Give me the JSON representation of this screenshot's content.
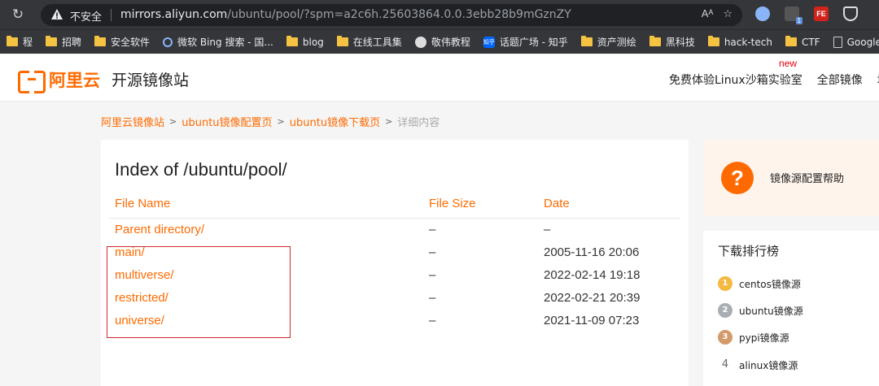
{
  "browser": {
    "insecure_label": "不安全",
    "url_host": "mirrors.aliyun.com",
    "url_path": "/ubuntu/pool/?spm=a2c6h.25603864.0.0.3ebb28b9mGznZY",
    "reader_label": "Aᴬ",
    "star_label": "☆",
    "reload_glyph": "↻",
    "badge_count": "1",
    "fe_label": "FE"
  },
  "bookmarks": [
    {
      "label": "程",
      "icon": "folder-icon"
    },
    {
      "label": "招聘",
      "icon": "folder-icon"
    },
    {
      "label": "安全软件",
      "icon": "folder-icon"
    },
    {
      "label": "微软 Bing 搜索 - 国...",
      "icon": "search-icon"
    },
    {
      "label": "blog",
      "icon": "folder-icon"
    },
    {
      "label": "在线工具集",
      "icon": "folder-icon"
    },
    {
      "label": "敬伟教程",
      "icon": "avatar-icon"
    },
    {
      "label": "话题广场 - 知乎",
      "icon": "zhihu-icon"
    },
    {
      "label": "资产测绘",
      "icon": "folder-icon"
    },
    {
      "label": "黑科技",
      "icon": "folder-icon"
    },
    {
      "label": "hack-tech",
      "icon": "folder-icon"
    },
    {
      "label": "CTF",
      "icon": "folder-icon"
    },
    {
      "label": "Google 翻译",
      "icon": "page-icon"
    }
  ],
  "zhihu_glyph": "知乎",
  "header": {
    "logo_text": "阿里云",
    "site_name": "开源镜像站",
    "nav": [
      "免费体验Linux沙箱实验室",
      "全部镜像",
      "域名"
    ],
    "new_badge": "new"
  },
  "breadcrumb": {
    "items": [
      "阿里云镜像站",
      "ubuntu镜像配置页",
      "ubuntu镜像下载页"
    ],
    "current": "详细内容",
    "separator": ">"
  },
  "listing": {
    "title": "Index of /ubuntu/pool/",
    "columns": [
      "File Name",
      "File Size",
      "Date"
    ],
    "rows": [
      {
        "name": "Parent directory/",
        "size": "–",
        "date": "–"
      },
      {
        "name": "main/",
        "size": "–",
        "date": "2005-11-16 20:06"
      },
      {
        "name": "multiverse/",
        "size": "–",
        "date": "2022-02-14 19:18"
      },
      {
        "name": "restricted/",
        "size": "–",
        "date": "2022-02-21 20:39"
      },
      {
        "name": "universe/",
        "size": "–",
        "date": "2021-11-09 07:23"
      }
    ]
  },
  "sidebar": {
    "help_label": "镜像源配置帮助",
    "help_glyph": "?",
    "rank_title": "下载排行榜",
    "rank_items": [
      {
        "rank": "1",
        "label": "centos镜像源"
      },
      {
        "rank": "2",
        "label": "ubuntu镜像源"
      },
      {
        "rank": "3",
        "label": "pypi镜像源"
      },
      {
        "rank": "4",
        "label": "alinux镜像源"
      }
    ]
  },
  "colors": {
    "accent": "#ff6a00",
    "highlight_border": "#d0262d"
  }
}
